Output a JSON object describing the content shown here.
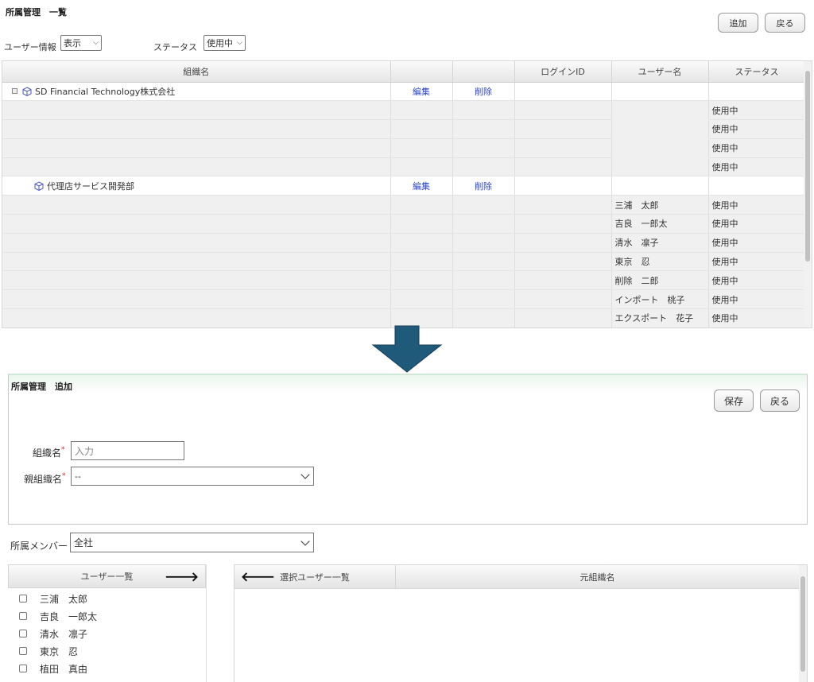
{
  "list_screen": {
    "title": "所属管理　一覧",
    "add_button": "追加",
    "back_button": "戻る",
    "user_info_label": "ユーザー情報",
    "user_info_value": "表示",
    "status_label": "ステータス",
    "status_value": "使用中",
    "columns": [
      "組織名",
      "",
      "",
      "ログインID",
      "ユーザー名",
      "ステータス"
    ],
    "org1": {
      "name": "SD Financial Technology株式会社",
      "edit": "編集",
      "delete": "削除"
    },
    "org1_statuses": [
      "使用中",
      "使用中",
      "使用中",
      "使用中"
    ],
    "org2": {
      "name": "代理店サービス開発部",
      "edit": "編集",
      "delete": "削除"
    },
    "org2_members": [
      {
        "name": "三浦　太郎",
        "status": "使用中"
      },
      {
        "name": "吉良　一郎太",
        "status": "使用中"
      },
      {
        "name": "清水　凛子",
        "status": "使用中"
      },
      {
        "name": "東京　忍",
        "status": "使用中"
      },
      {
        "name": "削除　二郎",
        "status": "使用中"
      },
      {
        "name": "インポート　桃子",
        "status": "使用中"
      },
      {
        "name": "エクスポート　花子",
        "status": "使用中"
      }
    ]
  },
  "add_screen": {
    "title": "所属管理　追加",
    "save_button": "保存",
    "back_button": "戻る",
    "org_name_label": "組織名",
    "org_name_placeholder": "入力",
    "parent_org_label": "親組織名",
    "parent_org_value": "--",
    "required_mark": "*",
    "member_label": "所属メンバー",
    "member_value": "全社",
    "user_list_header": "ユーザー一覧",
    "selected_list_header": "選択ユーザー一覧",
    "origin_org_header": "元組織名",
    "users": [
      "三浦　太郎",
      "吉良　一郎太",
      "清水　凛子",
      "東京　忍",
      "植田　真由"
    ]
  },
  "colors": {
    "link": "#2b44cc",
    "arrow": "#1f5a7a",
    "required": "#dd2222"
  },
  "icons": {
    "org": "cube-icon",
    "toggle": "tree-collapse-icon",
    "to_right": "arrow-right-icon",
    "to_left": "arrow-left-icon"
  }
}
